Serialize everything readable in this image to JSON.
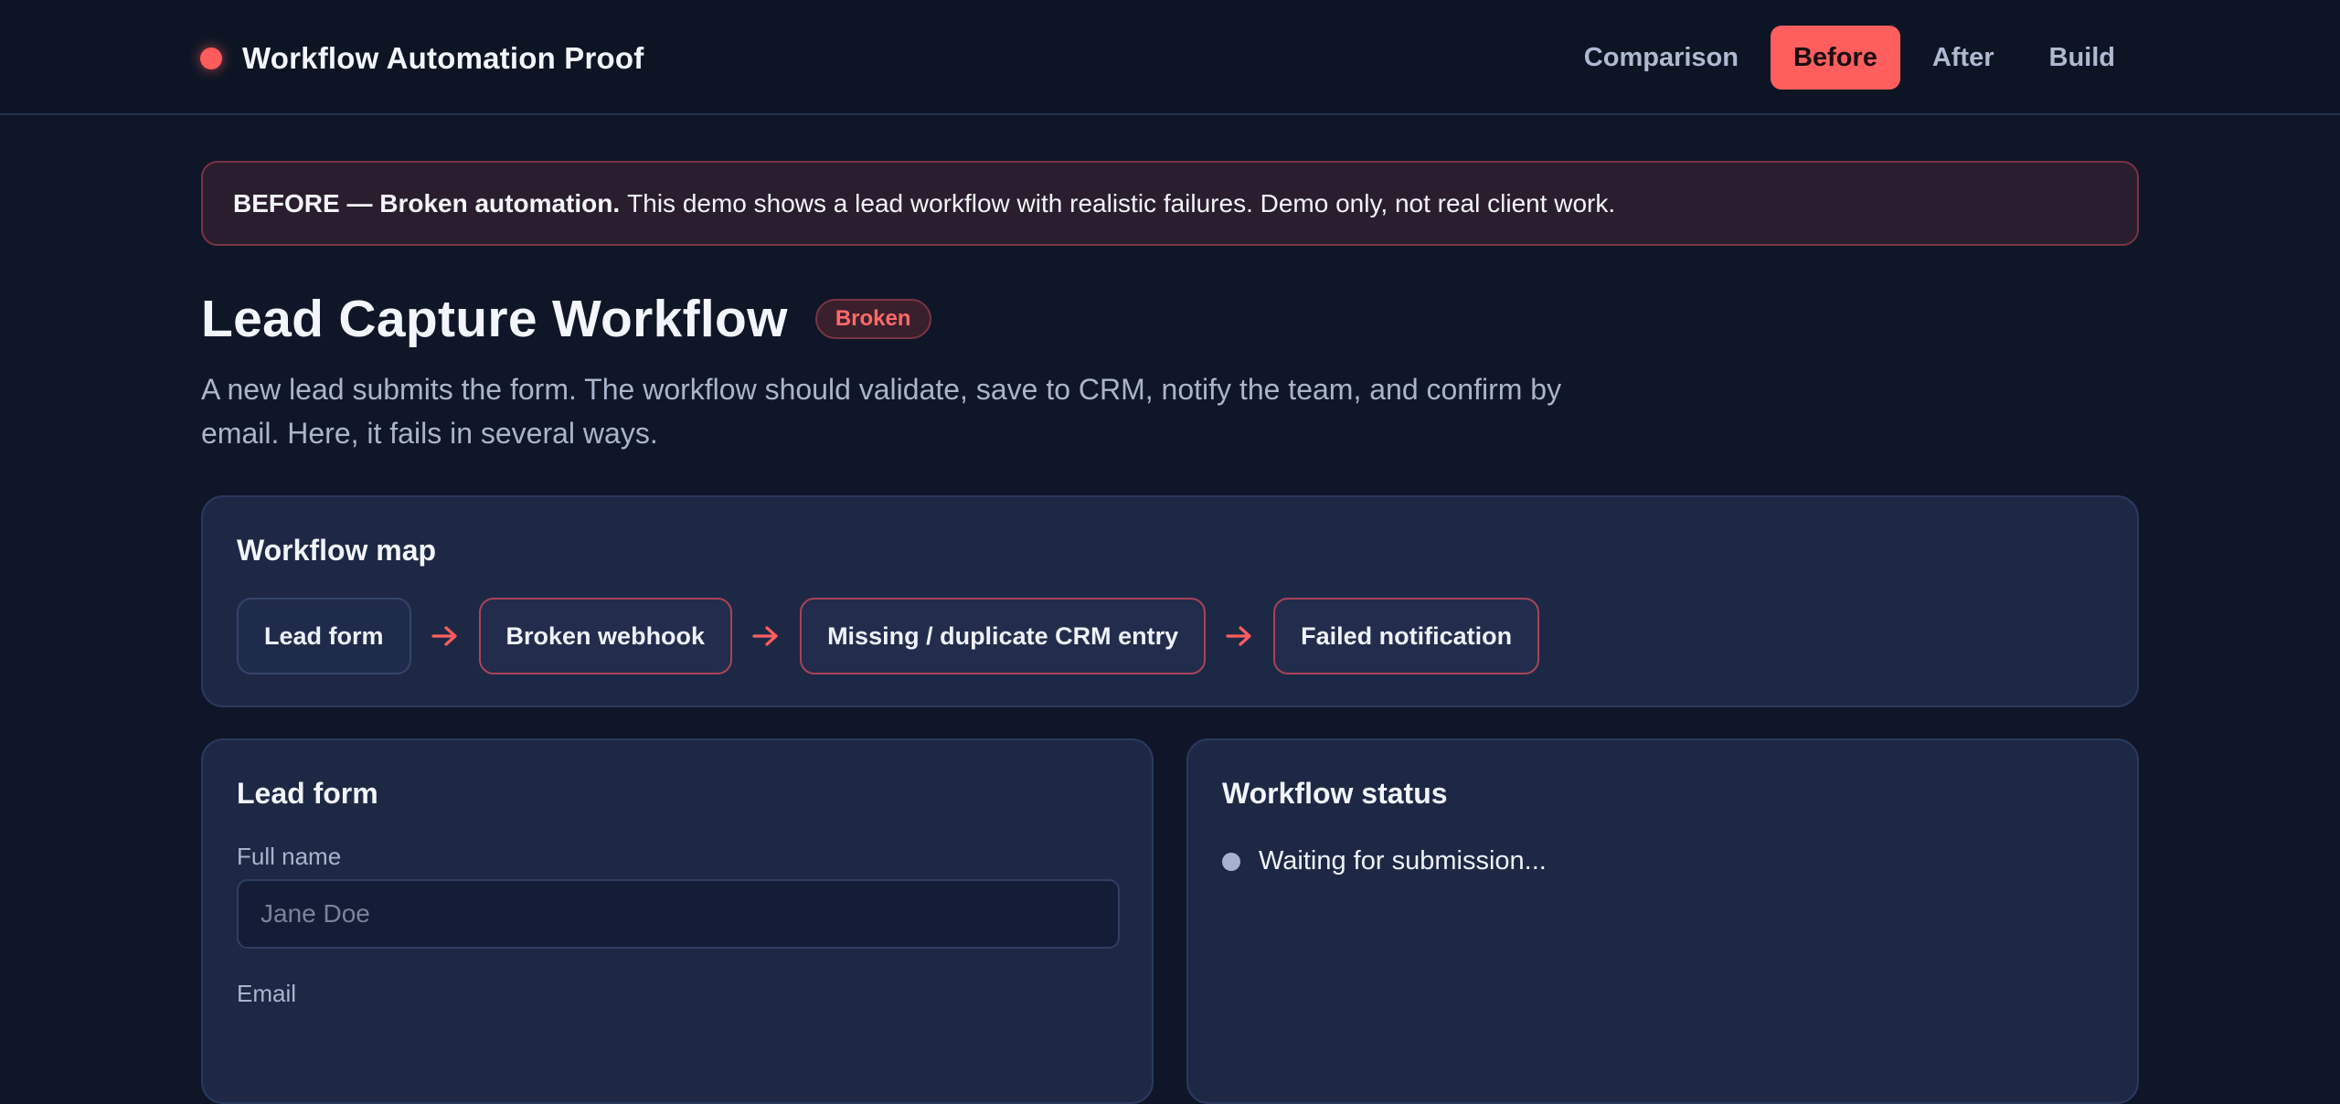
{
  "app": {
    "title": "Workflow Automation Proof"
  },
  "nav": {
    "items": [
      {
        "label": "Comparison",
        "active": false
      },
      {
        "label": "Before",
        "active": true
      },
      {
        "label": "After",
        "active": false
      },
      {
        "label": "Build",
        "active": false
      }
    ]
  },
  "banner": {
    "strong": "BEFORE — Broken automation.",
    "text": "This demo shows a lead workflow with realistic failures. Demo only, not real client work."
  },
  "page": {
    "title": "Lead Capture Workflow",
    "status_badge": "Broken",
    "description": "A new lead submits the form. The workflow should validate, save to CRM, notify the team, and confirm by email. Here, it fails in several ways."
  },
  "workflow_map": {
    "title": "Workflow map",
    "nodes": [
      {
        "label": "Lead form",
        "state": "normal"
      },
      {
        "label": "Broken webhook",
        "state": "broken"
      },
      {
        "label": "Missing / duplicate CRM entry",
        "state": "broken"
      },
      {
        "label": "Failed notification",
        "state": "broken"
      }
    ],
    "arrow_icon": "arrow-right-icon"
  },
  "lead_form": {
    "title": "Lead form",
    "full_name": {
      "label": "Full name",
      "placeholder": "Jane Doe",
      "value": ""
    },
    "email": {
      "label": "Email"
    }
  },
  "workflow_status": {
    "title": "Workflow status",
    "message": "Waiting for submission..."
  },
  "colors": {
    "accent": "#ff5e5e",
    "background": "#0e1627",
    "card": "#1d2845",
    "broken_border": "#a94457"
  }
}
